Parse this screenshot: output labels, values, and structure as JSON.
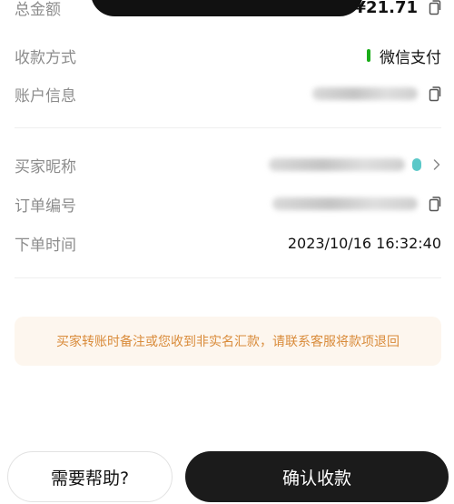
{
  "order": {
    "total_label": "总金额",
    "total_value": "¥21.71",
    "payment_label": "收款方式",
    "payment_value": "微信支付",
    "payment_color": "#1aad19",
    "account_label": "账户信息",
    "buyer_label": "买家昵称",
    "buyer_avatar_color": "#5bc8c8",
    "order_no_label": "订单编号",
    "order_time_label": "下单时间",
    "order_time_value": "2023/10/16 16:32:40"
  },
  "notice": {
    "text": "买家转账时备注或您收到非实名汇款，请联系客服将款项退回",
    "text_color": "#d98b3a",
    "bg_color": "#fdf6ee"
  },
  "footer": {
    "help_label": "需要帮助?",
    "confirm_label": "确认收款"
  },
  "icons": {
    "copy": "copy-icon",
    "chevron": "chevron-right-icon"
  }
}
